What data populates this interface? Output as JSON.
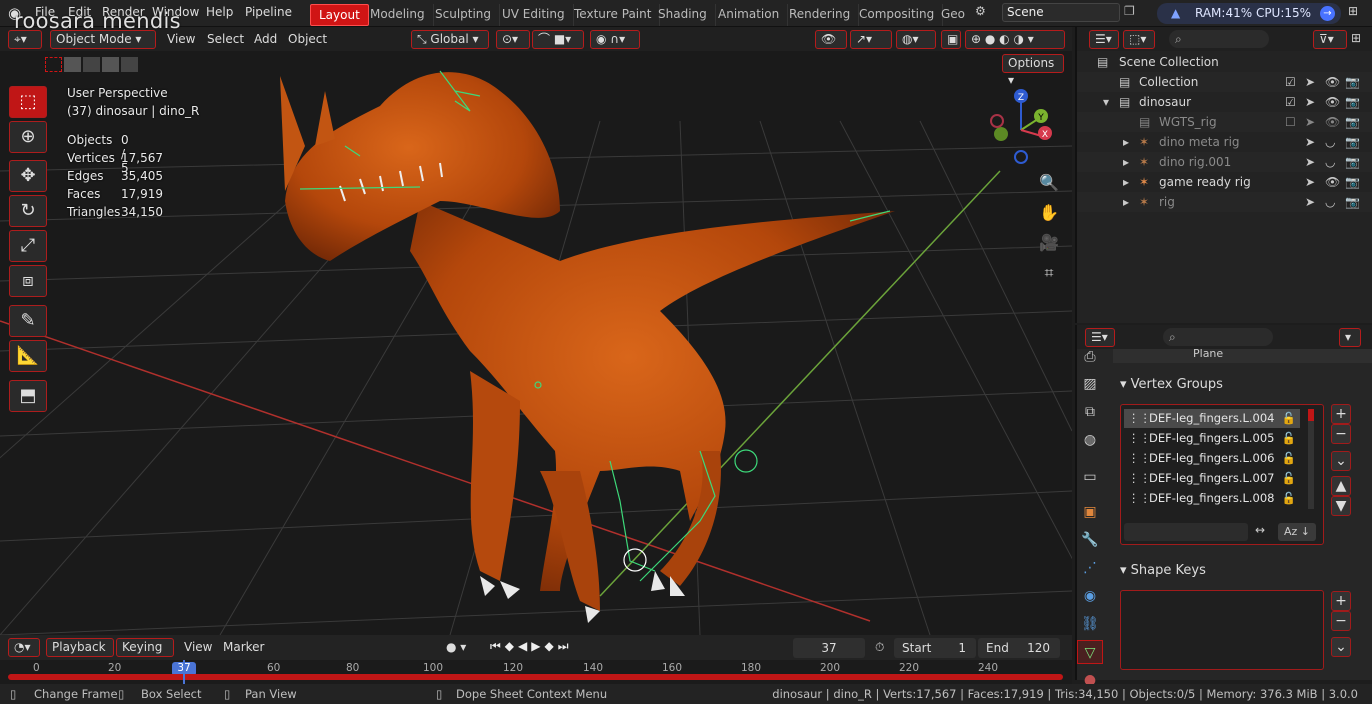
{
  "watermark": "roosara mendis",
  "topmenu": [
    "File",
    "Edit",
    "Render",
    "Window",
    "Help",
    "Pipeline"
  ],
  "workspaces": [
    "Layout",
    "Modeling",
    "Sculpting",
    "UV Editing",
    "Texture Paint",
    "Shading",
    "Animation",
    "Rendering",
    "Compositing",
    "Geo"
  ],
  "scene": "Scene",
  "system_stats": "RAM:41%  CPU:15%",
  "viewport_header": {
    "mode": "Object Mode",
    "menus": [
      "View",
      "Select",
      "Add",
      "Object"
    ],
    "orientation": "Global",
    "options": "Options"
  },
  "overlay": {
    "perspective": "User Perspective",
    "object": "(37) dinosaur | dino_R",
    "stats": [
      {
        "label": "Objects",
        "value": "0 / 5"
      },
      {
        "label": "Vertices",
        "value": "17,567"
      },
      {
        "label": "Edges",
        "value": "35,405"
      },
      {
        "label": "Faces",
        "value": "17,919"
      },
      {
        "label": "Triangles",
        "value": "34,150"
      }
    ]
  },
  "gizmo": {
    "z": "Z",
    "y": "Y",
    "x": "X"
  },
  "outliner": {
    "root": "Scene Collection",
    "items": [
      "Collection",
      "dinosaur",
      "WGTS_rig",
      "dino meta rig",
      "dino rig.001",
      "game ready rig",
      "rig"
    ]
  },
  "properties": {
    "object_name": "Plane",
    "vertex_groups_title": "Vertex Groups",
    "vertex_groups": [
      "DEF-leg_fingers.L.004",
      "DEF-leg_fingers.L.005",
      "DEF-leg_fingers.L.006",
      "DEF-leg_fingers.L.007",
      "DEF-leg_fingers.L.008"
    ],
    "shape_keys_title": "Shape Keys"
  },
  "timeline": {
    "menus": [
      "Playback",
      "Keying",
      "View",
      "Marker"
    ],
    "current_frame": "37",
    "start_label": "Start",
    "start": "1",
    "end_label": "End",
    "end": "120",
    "ticks": [
      "0",
      "20",
      "37",
      "60",
      "80",
      "100",
      "120",
      "140",
      "160",
      "180",
      "200",
      "220",
      "240"
    ]
  },
  "statusbar": {
    "change_frame": "Change Frame",
    "box_select": "Box Select",
    "pan_view": "Pan View",
    "context_menu": "Dope Sheet Context Menu",
    "info": "dinosaur | dino_R | Verts:17,567 | Faces:17,919 | Tris:34,150 | Objects:0/5 | Memory: 376.3 MiB | 3.0.0"
  },
  "colors": {
    "accent": "#d01515",
    "mesh": "#c4520d",
    "bone": "#3dd97a"
  }
}
